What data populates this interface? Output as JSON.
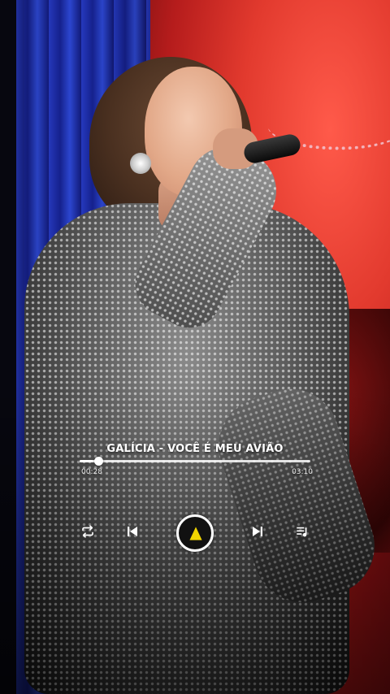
{
  "player": {
    "track_title": "GALÍCIA - VOCÊ É MEU AVIÃO",
    "elapsed": "00:28",
    "total": "03:10",
    "progress_fraction": 0.08
  },
  "controls": {
    "repeat": "repeat-icon",
    "previous": "skip-previous-icon",
    "play": "play-icon",
    "next": "skip-next-icon",
    "queue": "playlist-icon"
  },
  "colors": {
    "play_accent": "#f2d600",
    "text": "#ffffff"
  }
}
